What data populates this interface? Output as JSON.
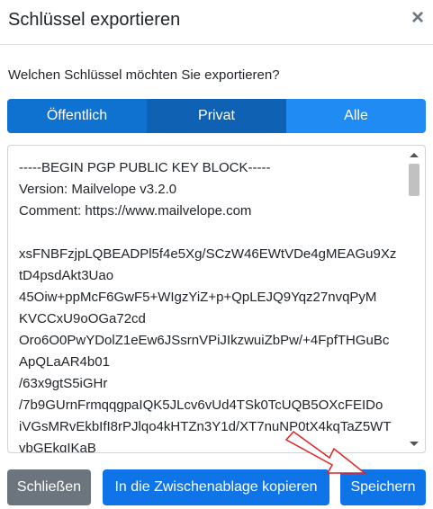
{
  "dialog": {
    "title": "Schlüssel exportieren",
    "close_symbol": "×",
    "question": "Welchen Schlüssel möchten Sie exportieren?"
  },
  "segments": [
    {
      "label": "Öffentlich",
      "state": "unselected"
    },
    {
      "label": "Privat",
      "state": "unselected"
    },
    {
      "label": "Alle",
      "state": "selected"
    }
  ],
  "key_text": "-----BEGIN PGP PUBLIC KEY BLOCK-----\nVersion: Mailvelope v3.2.0\nComment: https://www.mailvelope.com\n\nxsFNBFzjpLQBEADPl5f4e5Xg/SCzW46EWtVDe4gMEAGu9Xz\ntD4psdAkt3Uao\n45Oiw+ppMcF6GwF5+WIgzYiZ+p+QpLEJQ9Yqz27nvqPyM\nKVCCxU9oOGa72cd\nOro6O0PwYDolZ1eEw6JSsrnVPiJIkzwuiZbPw/+4FpfTHGuBc\nApQLaAR4b01\n/63x9gtS5iGHr\n/7b9GUrnFrmqqgpaIQK5JLcv6vUd4TSk0TcUQB5OXcFEIDo\niVGsMRvEkbIfI8rPJlqo4kHTZn3Y1d/XT7nuNP0tX4kqTaZ5WT\nvbGEkqIKaB",
  "buttons": {
    "close": "Schließen",
    "copy": "In die Zwischenablage kopieren",
    "save": "Speichern"
  },
  "colors": {
    "primary": "#0f74e8",
    "secondary": "#6c757d",
    "annotation_arrow": "#e02424"
  }
}
